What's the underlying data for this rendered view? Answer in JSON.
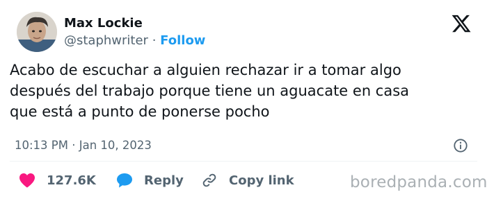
{
  "author": {
    "name": "Max Lockie",
    "handle": "@staphwriter",
    "separator": "·",
    "follow_label": "Follow"
  },
  "tweet": {
    "lines": [
      "Acabo de escuchar a alguien rechazar ir a tomar algo",
      "después del trabajo porque tiene un aguacate en casa",
      "que está a punto de ponerse pocho"
    ],
    "timestamp": "10:13 PM · Jan 10, 2023"
  },
  "actions": {
    "likes": "127.6K",
    "reply_label": "Reply",
    "copy_label": "Copy link"
  },
  "colors": {
    "accent": "#1d9bf0",
    "like": "#f91880",
    "muted": "#536471"
  },
  "icons": [
    "x-logo-icon",
    "info-icon",
    "heart-icon",
    "reply-bubble-icon",
    "link-icon"
  ],
  "watermark": "boredpanda.com"
}
